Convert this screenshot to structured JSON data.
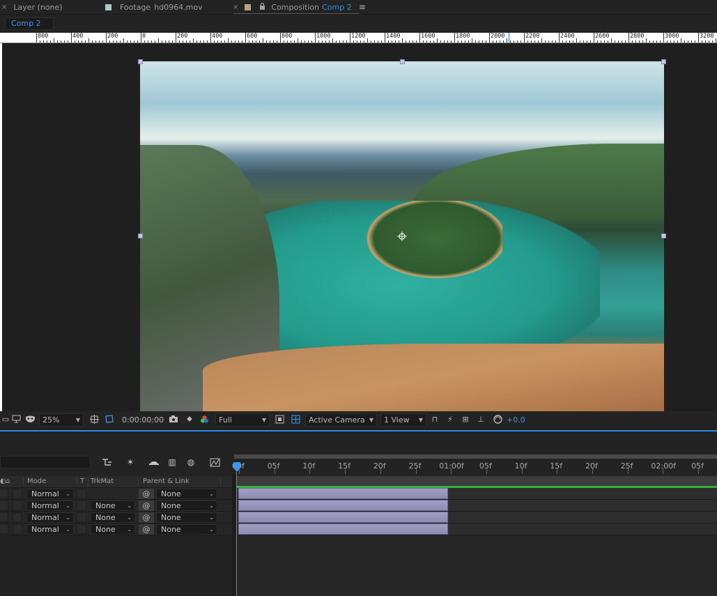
{
  "tabs": {
    "layer": {
      "close": "×",
      "label": "Layer (none)"
    },
    "footage": {
      "label": "Footage",
      "name": "hd0964.mov",
      "swatch": "#9fd0c8"
    },
    "composition": {
      "close": "×",
      "label": "Composition",
      "name": "Comp 2",
      "swatch": "#b8a27a",
      "menu": "≡"
    }
  },
  "comp_button": "Comp 2",
  "ruler": {
    "labels": [
      "800",
      "400",
      "200",
      "0",
      "200",
      "400",
      "600",
      "800",
      "1000",
      "1200",
      "1400",
      "1600",
      "1800",
      "2000",
      "2200",
      "2400",
      "2600",
      "2800",
      "3000",
      "3200"
    ]
  },
  "viewer_toolbar": {
    "zoom": "25%",
    "timecode": "0:00:00:00",
    "resolution": "Full",
    "camera": "Active Camera",
    "views": "1 View",
    "exposure": "+0.0"
  },
  "timeline": {
    "time_labels": [
      "00f",
      "05f",
      "10f",
      "15f",
      "20f",
      "25f",
      "01:00f",
      "05f",
      "10f",
      "15f",
      "20f",
      "25f",
      "02:00f",
      "05f"
    ],
    "columns": {
      "mode": "Mode",
      "t": "T",
      "trkmat": "TrkMat",
      "parent": "Parent & Link"
    },
    "layers": [
      {
        "mode": "Normal",
        "trkmat": "",
        "parent": "None"
      },
      {
        "mode": "Normal",
        "trkmat": "None",
        "parent": "None"
      },
      {
        "mode": "Normal",
        "trkmat": "None",
        "parent": "None"
      },
      {
        "mode": "Normal",
        "trkmat": "None",
        "parent": "None"
      }
    ]
  },
  "colors": {
    "accent": "#2d8ceb",
    "layer_bar": "#9a97bd",
    "work_area_green": "#2fb33b"
  }
}
